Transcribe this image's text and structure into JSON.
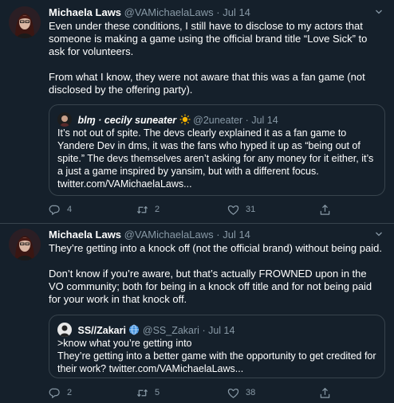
{
  "tweets": [
    {
      "author_name": "Michaela Laws",
      "handle": "@VAMichaelaLaws",
      "separator": "·",
      "date": "Jul 14",
      "paragraphs": [
        "Even under these conditions, I still have to disclose to my actors that someone is making a game using the official brand title “Love Sick” to ask for volunteers.",
        "From what I know, they were not aware that this was a fan game (not disclosed by the offering party)."
      ],
      "quote": {
        "author_name": "blɱ · cecily suneater",
        "emoji": "sun-emoji",
        "handle": "@2uneater",
        "separator": "·",
        "date": "Jul 14",
        "text": "It’s not out of spite. The devs clearly explained it as a fan game to Yandere Dev in dms, it was the fans who hyped it up as “being out of spite.” The devs themselves aren’t asking for any money for it either, it’s a just a game inspired by yansim, but with a different focus. twitter.com/VAMichaelaLaws..."
      },
      "actions": {
        "replies": "4",
        "retweets": "2",
        "likes": "31"
      }
    },
    {
      "author_name": "Michaela Laws",
      "handle": "@VAMichaelaLaws",
      "separator": "·",
      "date": "Jul 14",
      "paragraphs": [
        "They’re getting into a knock off (not the official brand) without being paid.",
        "Don’t know if you’re aware, but that’s actually FROWNED upon in the VO community; both for being in a knock off title and for not being paid for your work in that knock off."
      ],
      "quote": {
        "author_name": "SS//Zakari",
        "emoji": "globe-emoji",
        "handle": "@SS_Zakari",
        "separator": "·",
        "date": "Jul 14",
        "text_line1": ">know what you’re getting into",
        "text_line2": "They’re getting into a better game with the opportunity to get credited for their work? twitter.com/VAMichaelaLaws..."
      },
      "actions": {
        "replies": "2",
        "retweets": "5",
        "likes": "38"
      }
    }
  ],
  "colors": {
    "background": "#15202b",
    "border": "#38444d",
    "muted": "#8899a6",
    "text": "#ffffff"
  }
}
